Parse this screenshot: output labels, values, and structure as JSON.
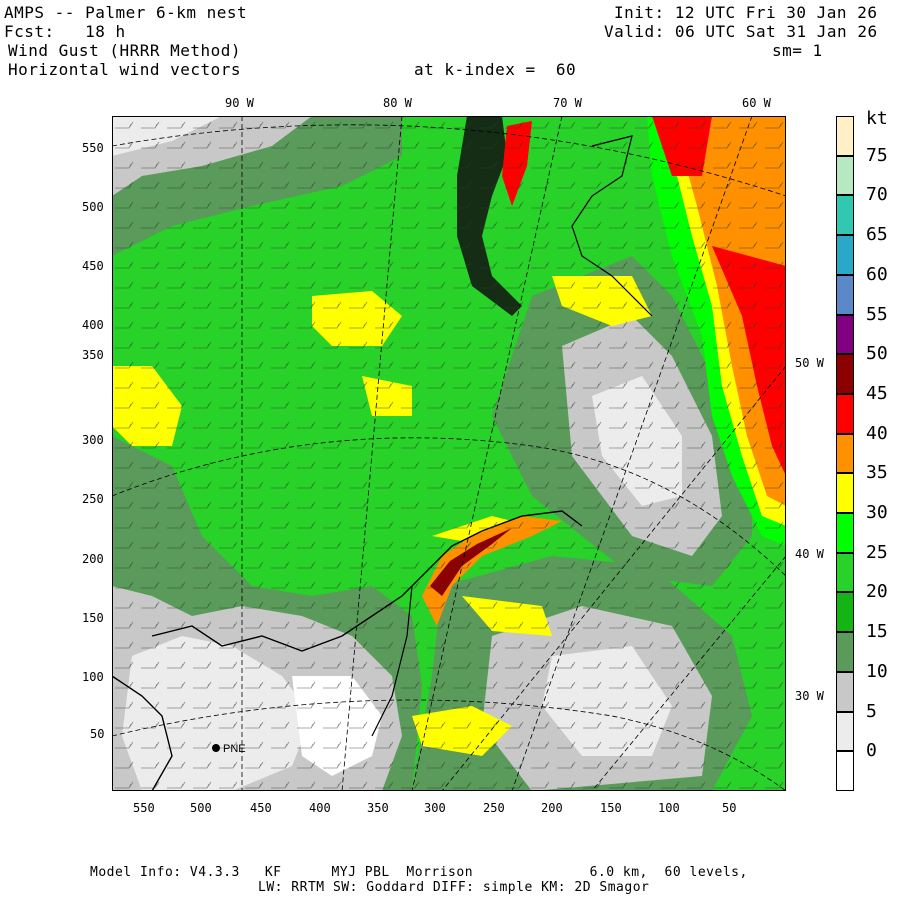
{
  "header": {
    "title": "AMPS -- Palmer 6-km nest",
    "forecast": "Fcst:   18 h",
    "field": "Wind Gust (HRRR Method)",
    "vectors": "Horizontal wind vectors",
    "k_index": "at k-index =  60",
    "init": "Init: 12 UTC Fri 30 Jan 26",
    "valid": "Valid: 06 UTC Sat 31 Jan 26",
    "smoothing": "sm= 1"
  },
  "map": {
    "lon_labels_top": [
      "90 W",
      "80 W",
      "70 W",
      "60 W"
    ],
    "lon_labels_right": [
      "50 W",
      "40 W",
      "30 W"
    ],
    "y_ticks": [
      "550",
      "500",
      "450",
      "400",
      "350",
      "300",
      "250",
      "200",
      "150",
      "100",
      "50"
    ],
    "x_ticks": [
      "550",
      "500",
      "450",
      "400",
      "350",
      "300",
      "250",
      "200",
      "150",
      "100",
      "50"
    ],
    "station_label": "PNE",
    "colors": {
      "c0": "#ffffff",
      "c5": "#ececec",
      "c10": "#c8c8c8",
      "c15": "#5a9a5a",
      "c20": "#14b414",
      "c25": "#28d228",
      "c30": "#00ff00",
      "c35": "#ffff00",
      "c40": "#ff9000",
      "c45": "#ff0000",
      "c50": "#8c0000",
      "c55": "#800080",
      "c60": "#5b88c8",
      "c65": "#2aa8c8",
      "c70": "#30c8b0",
      "c75": "#b8e8c0",
      "c80": "#fff0c8"
    }
  },
  "colorbar": {
    "unit": "kt",
    "labels": [
      "75",
      "70",
      "65",
      "60",
      "55",
      "50",
      "45",
      "40",
      "35",
      "30",
      "25",
      "20",
      "15",
      "10",
      "5",
      "0"
    ],
    "colors": [
      "#fff0c8",
      "#b8e8c0",
      "#30c8b0",
      "#2aa8c8",
      "#5b88c8",
      "#800080",
      "#8c0000",
      "#ff0000",
      "#ff9000",
      "#ffff00",
      "#00ff00",
      "#28d228",
      "#14b414",
      "#5a9a5a",
      "#c8c8c8",
      "#ececec",
      "#ffffff"
    ]
  },
  "footer": {
    "line1": "Model Info: V4.3.3   KF      MYJ PBL  Morrison              6.0 km,  60 levels,",
    "line2": "LW: RRTM SW: Goddard DIFF: simple KM: 2D Smagor"
  }
}
